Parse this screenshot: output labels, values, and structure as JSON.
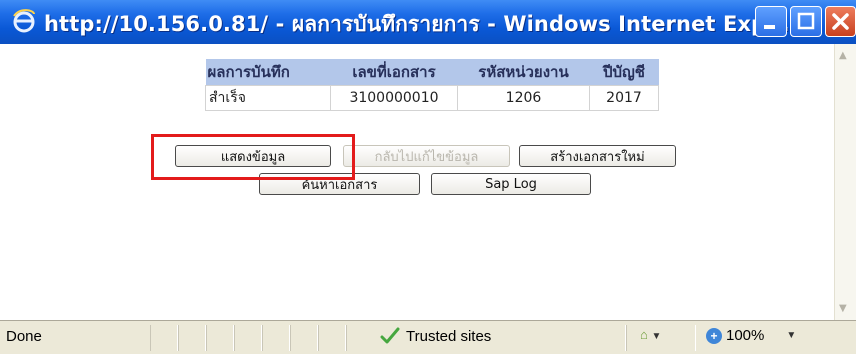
{
  "window": {
    "title": "http://10.156.0.81/ - ผลการบันทึกรายการ - Windows Internet Expl...",
    "accent_color": "#0a58d6",
    "close_color": "#d54b2a"
  },
  "result_table": {
    "headers": [
      "ผลการบันทึก",
      "เลขที่เอกสาร",
      "รหัสหน่วยงาน",
      "ปีบัญชี"
    ],
    "row": [
      "สำเร็จ",
      "3100000010",
      "1206",
      "2017"
    ]
  },
  "buttons": {
    "show_data": "แสดงข้อมูล",
    "go_back_edit": "กลับไปแก้ไขข้อมูล",
    "new_document": "สร้างเอกสารใหม่",
    "search_document": "ค้นหาเอกสาร",
    "sap_log": "Sap Log"
  },
  "highlight": {
    "color": "#e31b1b",
    "target": "show_data"
  },
  "statusbar": {
    "status": "Done",
    "zone": "Trusted sites",
    "zoom": "100%",
    "icons": [
      "check-icon",
      "security-zone-icon",
      "zoom-icon"
    ]
  }
}
